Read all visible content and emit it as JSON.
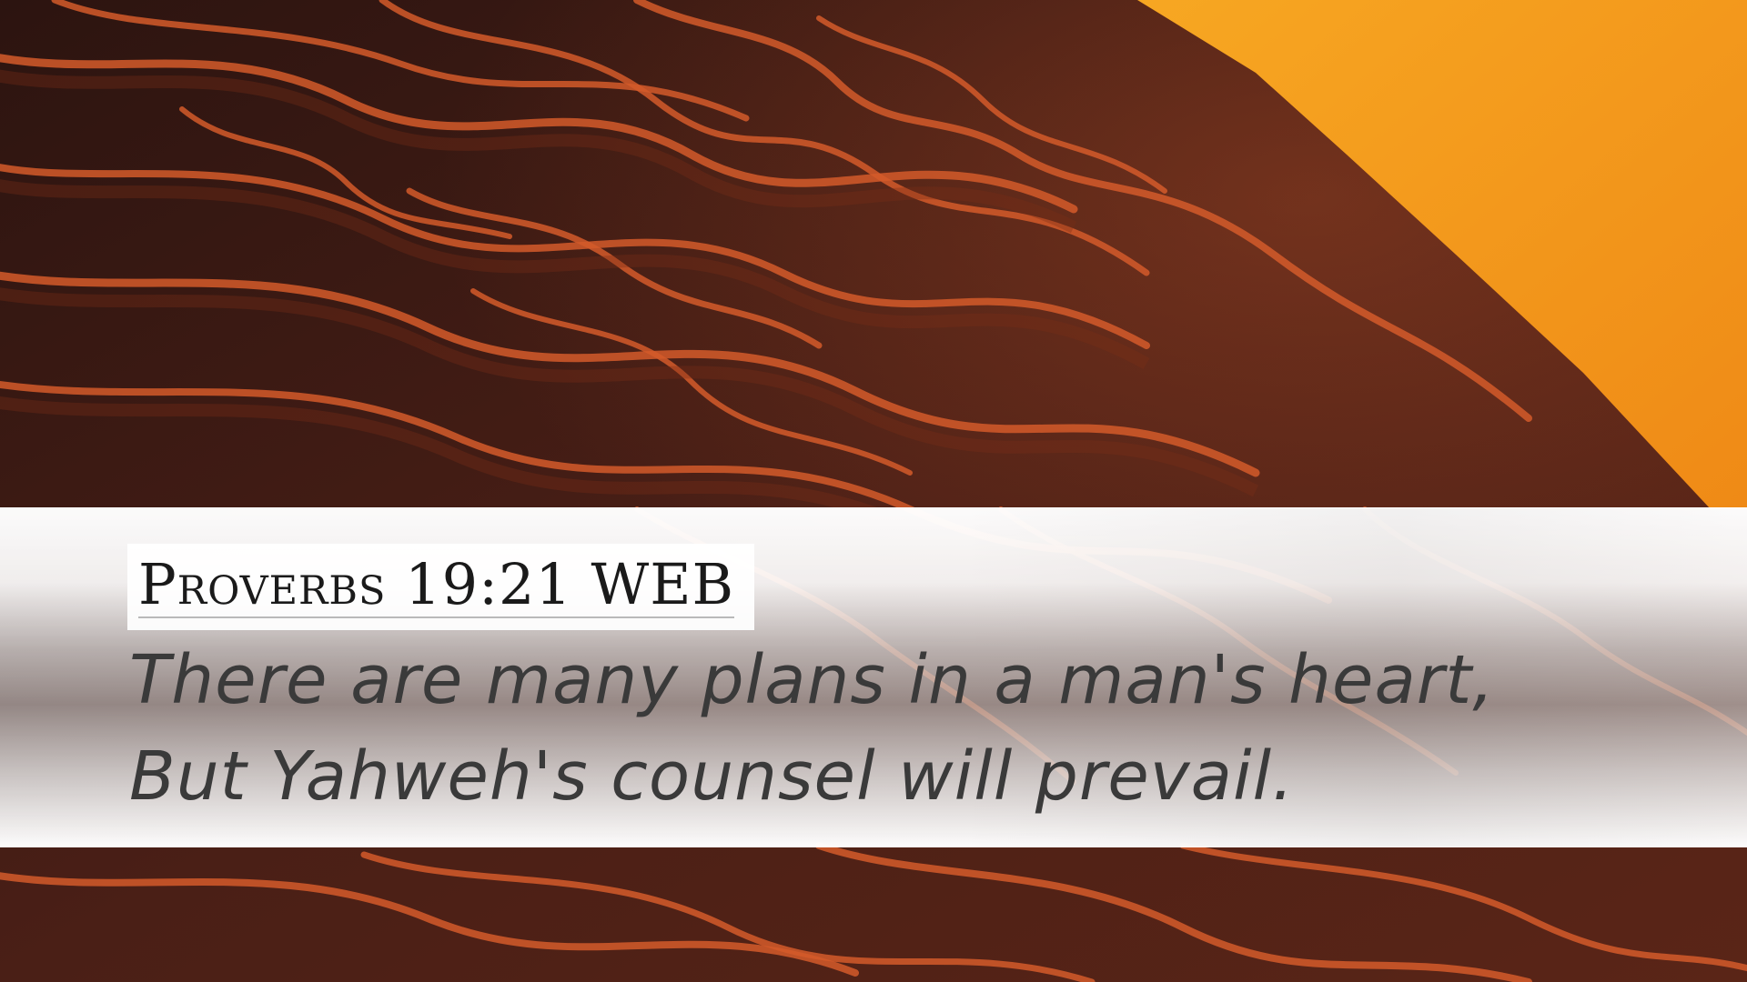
{
  "background": {
    "description_icon": "desert-sand-dune-icon",
    "colors": {
      "dune_shadow": "#3d1a14",
      "ripple_highlight": "#d9582a",
      "sunlit_sand": "#f59a1c"
    }
  },
  "reference": "Proverbs 19:21 WEB",
  "verse": {
    "line1": "There are many plans in a man's heart,",
    "line2": "But Yahweh's counsel will prevail."
  }
}
